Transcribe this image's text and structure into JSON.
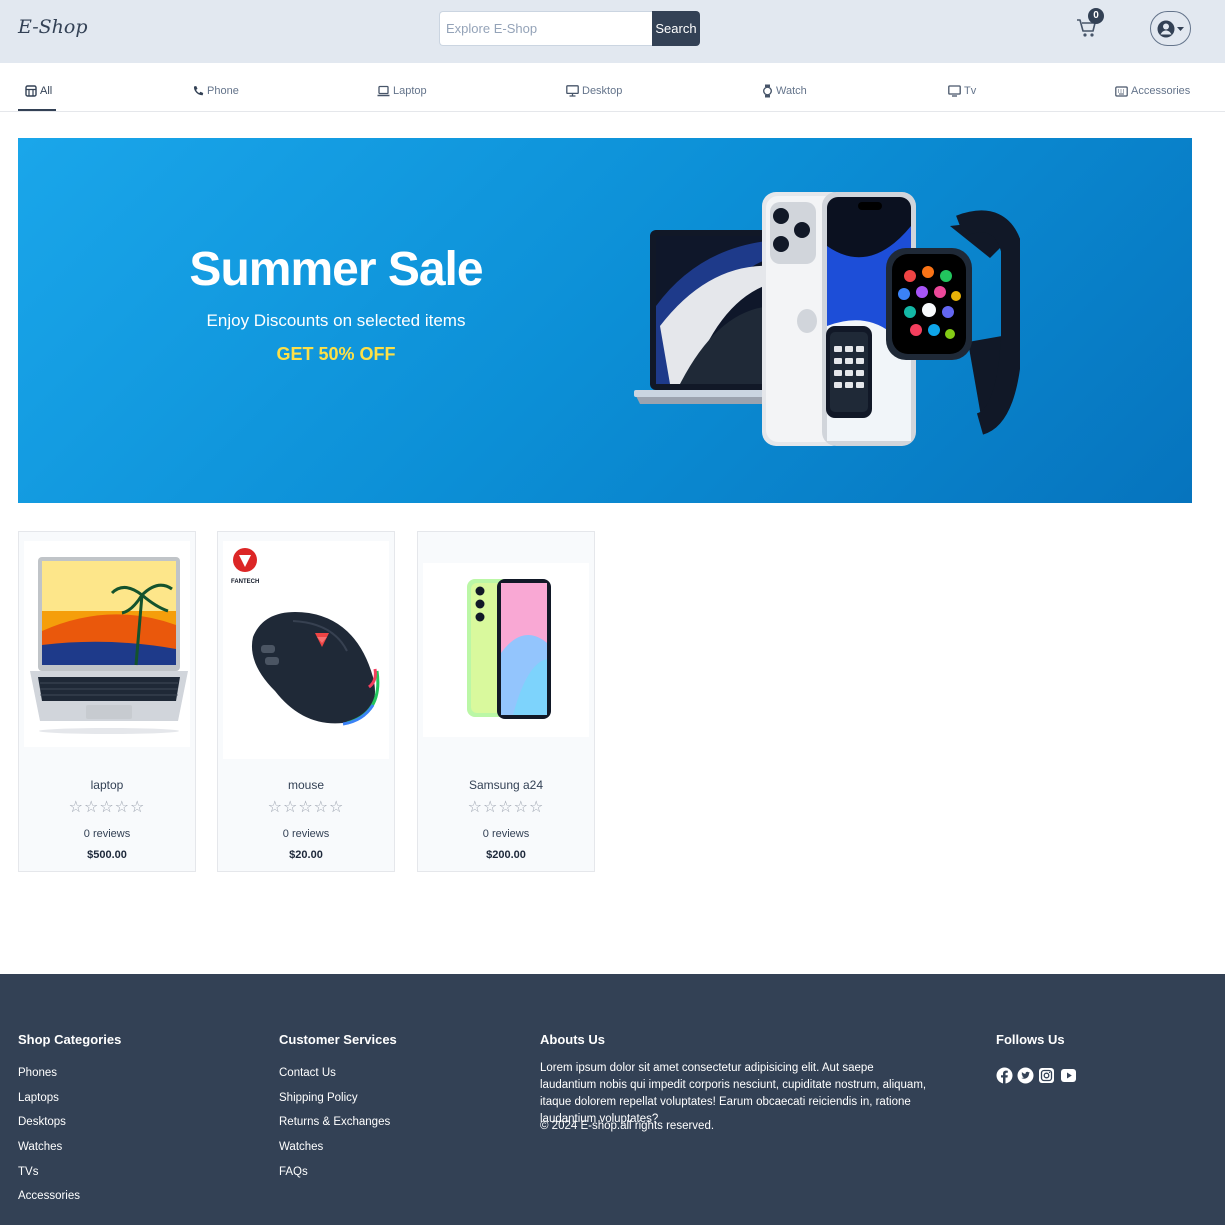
{
  "header": {
    "logo": "E-Shop",
    "search_placeholder": "Explore E-Shop",
    "search_button": "Search",
    "cart_count": "0"
  },
  "categories": [
    {
      "label": "All",
      "icon": "store-icon",
      "active": true
    },
    {
      "label": "Phone",
      "icon": "phone-icon"
    },
    {
      "label": "Laptop",
      "icon": "laptop-icon"
    },
    {
      "label": "Desktop",
      "icon": "desktop-icon"
    },
    {
      "label": "Watch",
      "icon": "watch-icon"
    },
    {
      "label": "Tv",
      "icon": "tv-icon"
    },
    {
      "label": "Accessories",
      "icon": "keyboard-icon"
    }
  ],
  "banner": {
    "title": "Summer Sale",
    "subtitle": "Enjoy Discounts on selected items",
    "offer": "GET 50% OFF"
  },
  "products": [
    {
      "name": "laptop",
      "rating": 0,
      "reviews": "0 reviews",
      "price": "$500.00"
    },
    {
      "name": "mouse",
      "rating": 0,
      "reviews": "0 reviews",
      "price": "$20.00"
    },
    {
      "name": "Samsung a24",
      "rating": 0,
      "reviews": "0 reviews",
      "price": "$200.00"
    }
  ],
  "product_stars": "☆☆☆☆☆",
  "mouse_brand": "FANTECH",
  "footer": {
    "shop_categories": {
      "title": "Shop Categories",
      "links": [
        "Phones",
        "Laptops",
        "Desktops",
        "Watches",
        "TVs",
        "Accessories"
      ]
    },
    "customer_services": {
      "title": "Customer Services",
      "links": [
        "Contact Us",
        "Shipping Policy",
        "Returns & Exchanges",
        "Watches",
        "FAQs"
      ]
    },
    "about": {
      "title": "Abouts Us",
      "text": "Lorem ipsum dolor sit amet consectetur adipisicing elit. Aut saepe laudantium nobis qui impedit corporis nesciunt, cupiditate nostrum, aliquam, itaque dolorem repellat voluptates! Earum obcaecati reiciendis in, ratione laudantium voluptates?",
      "copyright": "© 2024 E-shop.all rights reserved."
    },
    "follow": {
      "title": "Follows Us",
      "icons": [
        "facebook-icon",
        "twitter-icon",
        "instagram-icon",
        "youtube-icon"
      ]
    }
  },
  "colors": {
    "header_bg": "#e2e8f0",
    "primary": "#334155",
    "banner_blue": "#0c8fd6",
    "offer_yellow": "#fde047",
    "footer_bg": "#334155"
  }
}
